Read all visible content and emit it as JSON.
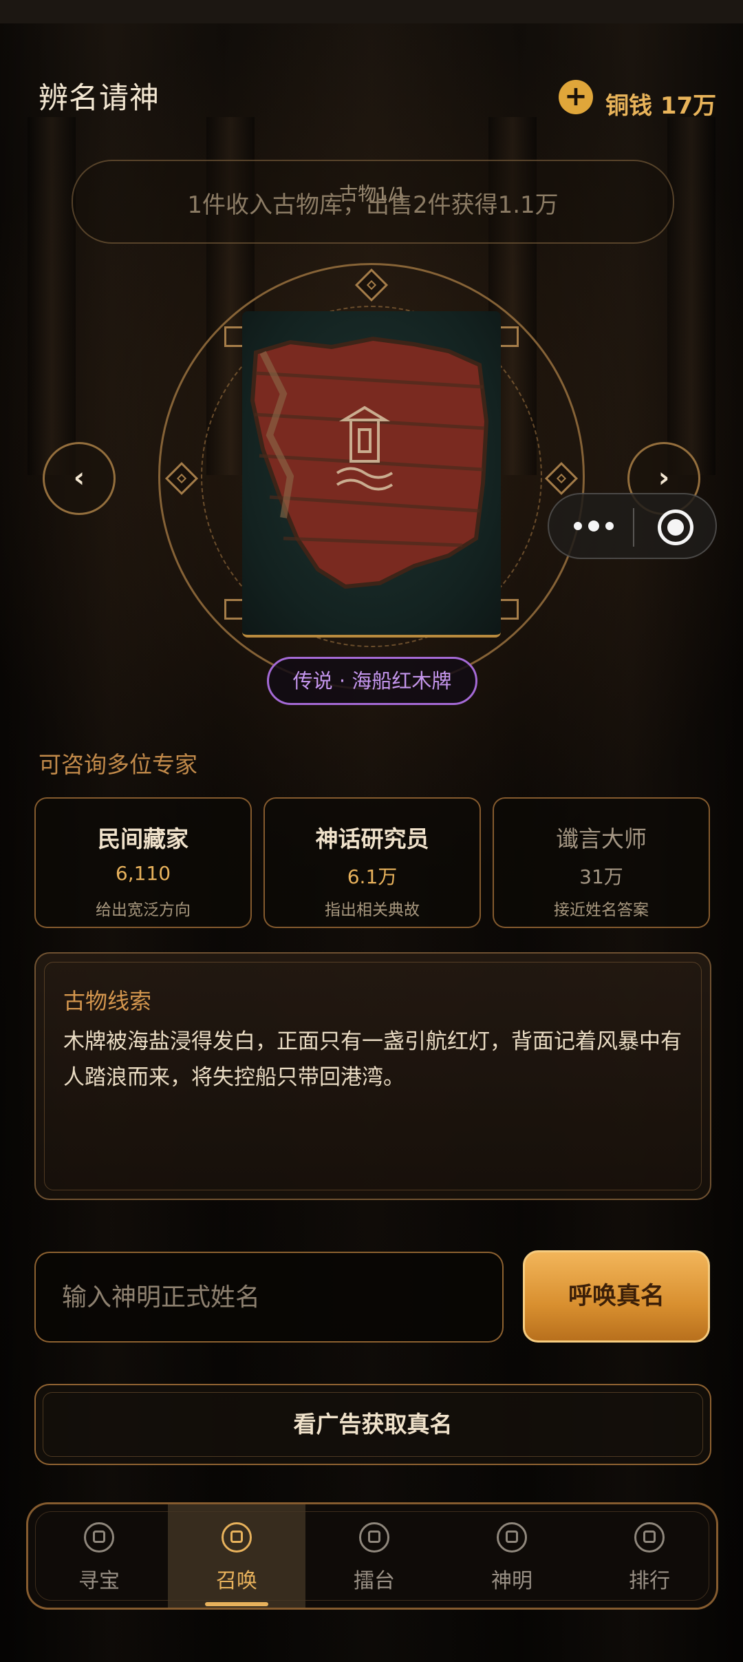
{
  "header": {
    "title": "辨名请神",
    "coins_label": "铜钱 17万"
  },
  "banner": {
    "counter": "古物1/1",
    "text": "1件收入古物库，出售2件获得1.1万"
  },
  "artifact": {
    "rarity_label": "传说 · 海船红木牌",
    "rarity_color": "#a56ad6"
  },
  "experts": {
    "section_title": "可咨询多位专家",
    "items": [
      {
        "name": "民间藏家",
        "price": "6,110",
        "desc": "给出宽泛方向"
      },
      {
        "name": "神话研究员",
        "price": "6.1万",
        "desc": "指出相关典故"
      },
      {
        "name": "谶言大师",
        "price": "31万",
        "desc": "接近姓名答案"
      }
    ]
  },
  "clue": {
    "title": "古物线索",
    "text": "木牌被海盐浸得发白，正面只有一盏引航红灯，背面记着风暴中有人踏浪而来，将失控船只带回港湾。"
  },
  "answer": {
    "placeholder": "输入神明正式姓名",
    "value": "",
    "summon_label": "呼唤真名"
  },
  "ad_button": {
    "label": "看广告获取真名"
  },
  "tabs": [
    {
      "label": "寻宝",
      "icon": "treasure-icon",
      "active": false
    },
    {
      "label": "召唤",
      "icon": "summon-icon",
      "active": true
    },
    {
      "label": "擂台",
      "icon": "arena-icon",
      "active": false
    },
    {
      "label": "神明",
      "icon": "deity-icon",
      "active": false
    },
    {
      "label": "排行",
      "icon": "ranking-icon",
      "active": false
    }
  ],
  "colors": {
    "accent_gold": "#e8b25c",
    "button_orange": "#d88f2f",
    "legendary_purple": "#a56ad6"
  }
}
